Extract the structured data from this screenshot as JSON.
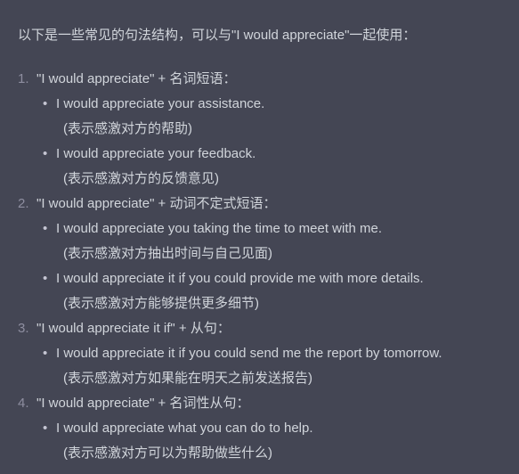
{
  "intro": "以下是一些常见的句法结构，可以与\"I would appreciate\"一起使用：",
  "sections": [
    {
      "number": "1.",
      "heading": "\"I would appreciate\" + 名词短语：",
      "examples": [
        {
          "text": "I would appreciate your assistance.",
          "note": "(表示感激对方的帮助)"
        },
        {
          "text": "I would appreciate your feedback.",
          "note": "(表示感激对方的反馈意见)"
        }
      ]
    },
    {
      "number": "2.",
      "heading": "\"I would appreciate\" + 动词不定式短语：",
      "examples": [
        {
          "text": "I would appreciate you taking the time to meet with me.",
          "note": "(表示感激对方抽出时间与自己见面)"
        },
        {
          "text": "I would appreciate it if you could provide me with more details.",
          "note": "(表示感激对方能够提供更多细节)"
        }
      ]
    },
    {
      "number": "3.",
      "heading": "\"I would appreciate it if\" + 从句：",
      "examples": [
        {
          "text": "I would appreciate it if you could send me the report by tomorrow.",
          "note": "(表示感激对方如果能在明天之前发送报告)"
        }
      ]
    },
    {
      "number": "4.",
      "heading": "\"I would appreciate\" + 名词性从句：",
      "examples": [
        {
          "text": "I would appreciate what you can do to help.",
          "note": "(表示感激对方可以为帮助做些什么)"
        }
      ]
    }
  ],
  "colors": {
    "background": "#444654",
    "text": "#d1d5db",
    "list_number": "#8e8ea0"
  }
}
